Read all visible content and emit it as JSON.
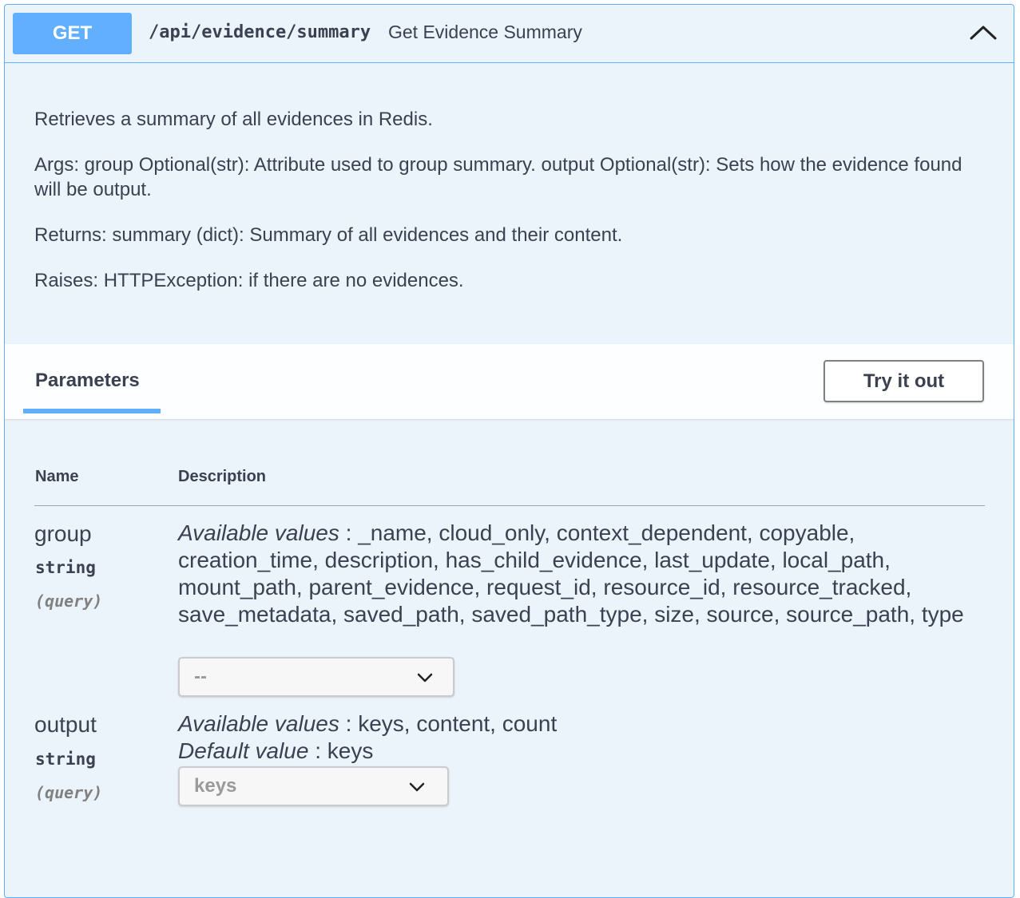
{
  "operation": {
    "method": "GET",
    "path": "/api/evidence/summary",
    "summary": "Get Evidence Summary",
    "collapse_icon": "chevron-up-icon",
    "method_color": "#61affe"
  },
  "description": [
    "Retrieves a summary of all evidences in Redis.",
    "Args: group Optional(str): Attribute used to group summary. output Optional(str): Sets how the evidence found will be output.",
    "Returns: summary (dict): Summary of all evidences and their content.",
    "Raises: HTTPException: if there are no evidences."
  ],
  "parameters_section": {
    "title": "Parameters",
    "try_button": "Try it out",
    "col_name": "Name",
    "col_description": "Description"
  },
  "params": [
    {
      "name": "group",
      "type": "string",
      "in": "(query)",
      "available_label": "Available values",
      "available_values": "_name, cloud_only, context_dependent, copyable, creation_time, description, has_child_evidence, last_update, local_path, mount_path, parent_evidence, request_id, resource_id, resource_tracked, save_metadata, saved_path, saved_path_type, size, source, source_path, type",
      "select_value": "--"
    },
    {
      "name": "output",
      "type": "string",
      "in": "(query)",
      "available_label": "Available values",
      "available_values": "keys, content, count",
      "default_label": "Default value",
      "default_value": "keys",
      "select_value": "keys"
    }
  ]
}
